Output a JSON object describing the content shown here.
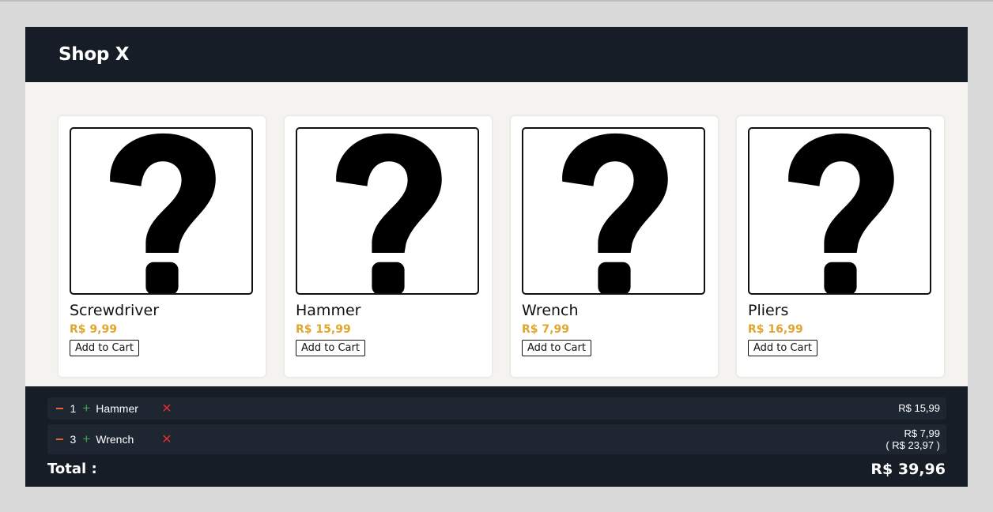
{
  "app": {
    "title": "Shop X"
  },
  "products": [
    {
      "name": "Screwdriver",
      "price": "R$ 9,99",
      "button": "Add to Cart",
      "image_icon": "question-mark-icon"
    },
    {
      "name": "Hammer",
      "price": "R$ 15,99",
      "button": "Add to Cart",
      "image_icon": "question-mark-icon"
    },
    {
      "name": "Wrench",
      "price": "R$ 7,99",
      "button": "Add to Cart",
      "image_icon": "question-mark-icon"
    },
    {
      "name": "Pliers",
      "price": "R$ 16,99",
      "button": "Add to Cart",
      "image_icon": "question-mark-icon"
    }
  ],
  "cart": {
    "items": [
      {
        "decrease": "−",
        "quantity": "1",
        "increase": "+",
        "name": "Hammer",
        "remove": "✕",
        "unit_price": "R$ 15,99",
        "subtotal": ""
      },
      {
        "decrease": "−",
        "quantity": "3",
        "increase": "+",
        "name": "Wrench",
        "remove": "✕",
        "unit_price": "R$ 7,99",
        "subtotal": "( R$ 23,97 )"
      }
    ],
    "total_label": "Total :",
    "total_value": "R$ 39,96"
  },
  "colors": {
    "header_bg": "#161d26",
    "page_bg": "#f4f3ef",
    "price": "#e0a62d",
    "decrease": "#e8692b",
    "increase": "#3aa94e",
    "remove": "#e22d2d"
  }
}
